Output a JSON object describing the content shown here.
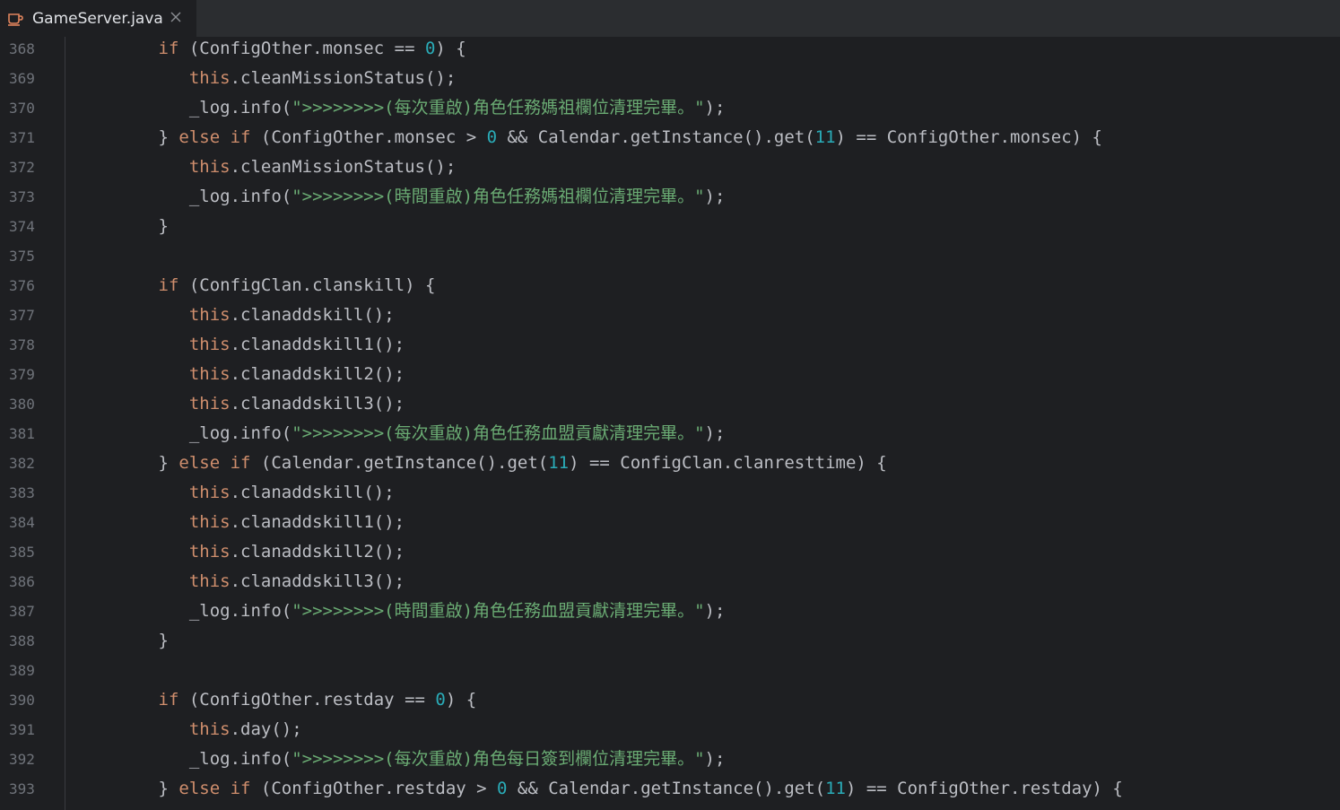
{
  "tab": {
    "filename": "GameServer.java",
    "icon": "java-file-icon",
    "close_icon": "close-icon"
  },
  "colors": {
    "keyword": "#cf8e6d",
    "string": "#6aab73",
    "number": "#2aacb8",
    "plain": "#bcbec4",
    "line_number": "#6f737a",
    "background": "#1e1f22"
  },
  "lines": [
    {
      "num": "368",
      "indent": "        ",
      "tokens": [
        [
          "kw",
          "if"
        ],
        [
          "plain",
          " (ConfigOther.monsec == "
        ],
        [
          "num",
          "0"
        ],
        [
          "plain",
          ") {"
        ]
      ]
    },
    {
      "num": "369",
      "indent": "           ",
      "tokens": [
        [
          "kw",
          "this"
        ],
        [
          "plain",
          ".cleanMissionStatus();"
        ]
      ]
    },
    {
      "num": "370",
      "indent": "           ",
      "tokens": [
        [
          "plain",
          "_log.info("
        ],
        [
          "str",
          "\">>>>>>>>(每次重啟)角色任務媽祖欄位清理完畢。\""
        ],
        [
          "plain",
          ");"
        ]
      ]
    },
    {
      "num": "371",
      "indent": "        ",
      "tokens": [
        [
          "plain",
          "} "
        ],
        [
          "kw",
          "else if"
        ],
        [
          "plain",
          " (ConfigOther.monsec > "
        ],
        [
          "num",
          "0"
        ],
        [
          "plain",
          " && Calendar.getInstance().get("
        ],
        [
          "num",
          "11"
        ],
        [
          "plain",
          ") == ConfigOther.monsec) {"
        ]
      ]
    },
    {
      "num": "372",
      "indent": "           ",
      "tokens": [
        [
          "kw",
          "this"
        ],
        [
          "plain",
          ".cleanMissionStatus();"
        ]
      ]
    },
    {
      "num": "373",
      "indent": "           ",
      "tokens": [
        [
          "plain",
          "_log.info("
        ],
        [
          "str",
          "\">>>>>>>>(時間重啟)角色任務媽祖欄位清理完畢。\""
        ],
        [
          "plain",
          ");"
        ]
      ]
    },
    {
      "num": "374",
      "indent": "        ",
      "tokens": [
        [
          "plain",
          "}"
        ]
      ]
    },
    {
      "num": "375",
      "indent": "",
      "tokens": []
    },
    {
      "num": "376",
      "indent": "        ",
      "tokens": [
        [
          "kw",
          "if"
        ],
        [
          "plain",
          " (ConfigClan.clanskill) {"
        ]
      ]
    },
    {
      "num": "377",
      "indent": "           ",
      "tokens": [
        [
          "kw",
          "this"
        ],
        [
          "plain",
          ".clanaddskill();"
        ]
      ]
    },
    {
      "num": "378",
      "indent": "           ",
      "tokens": [
        [
          "kw",
          "this"
        ],
        [
          "plain",
          ".clanaddskill1();"
        ]
      ]
    },
    {
      "num": "379",
      "indent": "           ",
      "tokens": [
        [
          "kw",
          "this"
        ],
        [
          "plain",
          ".clanaddskill2();"
        ]
      ]
    },
    {
      "num": "380",
      "indent": "           ",
      "tokens": [
        [
          "kw",
          "this"
        ],
        [
          "plain",
          ".clanaddskill3();"
        ]
      ]
    },
    {
      "num": "381",
      "indent": "           ",
      "tokens": [
        [
          "plain",
          "_log.info("
        ],
        [
          "str",
          "\">>>>>>>>(每次重啟)角色任務血盟貢獻清理完畢。\""
        ],
        [
          "plain",
          ");"
        ]
      ]
    },
    {
      "num": "382",
      "indent": "        ",
      "tokens": [
        [
          "plain",
          "} "
        ],
        [
          "kw",
          "else if"
        ],
        [
          "plain",
          " (Calendar.getInstance().get("
        ],
        [
          "num",
          "11"
        ],
        [
          "plain",
          ") == ConfigClan.clanresttime) {"
        ]
      ]
    },
    {
      "num": "383",
      "indent": "           ",
      "tokens": [
        [
          "kw",
          "this"
        ],
        [
          "plain",
          ".clanaddskill();"
        ]
      ]
    },
    {
      "num": "384",
      "indent": "           ",
      "tokens": [
        [
          "kw",
          "this"
        ],
        [
          "plain",
          ".clanaddskill1();"
        ]
      ]
    },
    {
      "num": "385",
      "indent": "           ",
      "tokens": [
        [
          "kw",
          "this"
        ],
        [
          "plain",
          ".clanaddskill2();"
        ]
      ]
    },
    {
      "num": "386",
      "indent": "           ",
      "tokens": [
        [
          "kw",
          "this"
        ],
        [
          "plain",
          ".clanaddskill3();"
        ]
      ]
    },
    {
      "num": "387",
      "indent": "           ",
      "tokens": [
        [
          "plain",
          "_log.info("
        ],
        [
          "str",
          "\">>>>>>>>(時間重啟)角色任務血盟貢獻清理完畢。\""
        ],
        [
          "plain",
          ");"
        ]
      ]
    },
    {
      "num": "388",
      "indent": "        ",
      "tokens": [
        [
          "plain",
          "}"
        ]
      ]
    },
    {
      "num": "389",
      "indent": "",
      "tokens": []
    },
    {
      "num": "390",
      "indent": "        ",
      "tokens": [
        [
          "kw",
          "if"
        ],
        [
          "plain",
          " (ConfigOther.restday == "
        ],
        [
          "num",
          "0"
        ],
        [
          "plain",
          ") {"
        ]
      ]
    },
    {
      "num": "391",
      "indent": "           ",
      "tokens": [
        [
          "kw",
          "this"
        ],
        [
          "plain",
          ".day();"
        ]
      ]
    },
    {
      "num": "392",
      "indent": "           ",
      "tokens": [
        [
          "plain",
          "_log.info("
        ],
        [
          "str",
          "\">>>>>>>>(每次重啟)角色每日簽到欄位清理完畢。\""
        ],
        [
          "plain",
          ");"
        ]
      ]
    },
    {
      "num": "393",
      "indent": "        ",
      "tokens": [
        [
          "plain",
          "} "
        ],
        [
          "kw",
          "else if"
        ],
        [
          "plain",
          " (ConfigOther.restday > "
        ],
        [
          "num",
          "0"
        ],
        [
          "plain",
          " && Calendar.getInstance().get("
        ],
        [
          "num",
          "11"
        ],
        [
          "plain",
          ") == ConfigOther.restday) {"
        ]
      ]
    }
  ]
}
